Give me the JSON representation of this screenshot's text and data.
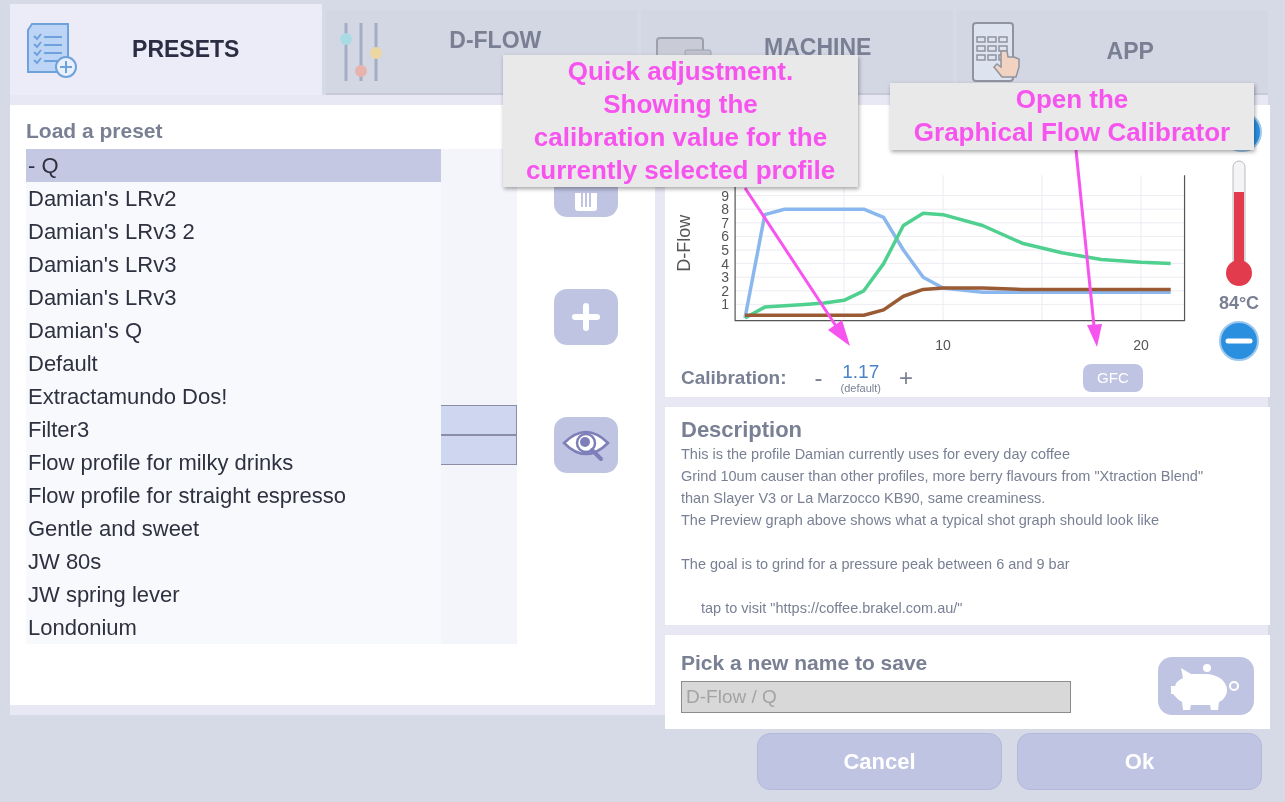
{
  "tabs": [
    {
      "label": "PRESETS",
      "selected": true
    },
    {
      "label": "D-FLOW",
      "selected": false
    },
    {
      "label": "MACHINE",
      "selected": false
    },
    {
      "label": "APP",
      "selected": false
    }
  ],
  "presets": {
    "title": "Load a preset",
    "items": [
      {
        "label": "-  Q",
        "selected": true
      },
      {
        "label": "Damian's LRv2",
        "selected": false
      },
      {
        "label": "Damian's LRv3 2",
        "selected": false
      },
      {
        "label": "Damian's LRv3",
        "selected": false
      },
      {
        "label": "Damian's LRv3",
        "selected": false
      },
      {
        "label": "Damian's Q",
        "selected": false
      },
      {
        "label": "Default",
        "selected": false
      },
      {
        "label": "Extractamundo Dos!",
        "selected": false
      },
      {
        "label": "Filter3",
        "selected": false
      },
      {
        "label": "Flow profile for milky drinks",
        "selected": false
      },
      {
        "label": "Flow profile for straight espresso",
        "selected": false
      },
      {
        "label": "Gentle and sweet",
        "selected": false
      },
      {
        "label": "JW 80s",
        "selected": false
      },
      {
        "label": "JW spring lever",
        "selected": false
      },
      {
        "label": "Londonium",
        "selected": false
      }
    ]
  },
  "preview": {
    "chart_data": {
      "type": "line",
      "ylabel": "D-Flow",
      "x": [
        0,
        1,
        2,
        3,
        4,
        5,
        6,
        7,
        8,
        9,
        10,
        12,
        14,
        16,
        18,
        20,
        21.5
      ],
      "series": [
        {
          "color": "#8ab8ee",
          "values": [
            0,
            7.6,
            8,
            8,
            8,
            8,
            8,
            7.4,
            5,
            3,
            2.2,
            1.9,
            1.9,
            1.9,
            1.9,
            1.9,
            1.9
          ]
        },
        {
          "color": "#4fd08f",
          "values": [
            0,
            0.8,
            0.9,
            1,
            1.1,
            1.3,
            2,
            4,
            6.8,
            7.7,
            7.6,
            6.8,
            5.5,
            4.8,
            4.3,
            4.1,
            4.0
          ]
        },
        {
          "color": "#9a5b34",
          "values": [
            0.2,
            0.2,
            0.2,
            0.2,
            0.2,
            0.2,
            0.2,
            0.6,
            1.6,
            2.1,
            2.2,
            2.2,
            2.1,
            2.1,
            2.1,
            2.1,
            2.1
          ]
        }
      ],
      "xlim": [
        -0.5,
        22.2
      ],
      "ylim": [
        -0.2,
        10.5
      ],
      "grid": true,
      "xticks": [
        10,
        20
      ],
      "yticks": [
        1,
        2,
        3,
        4,
        5,
        6,
        7,
        8,
        9
      ]
    },
    "calibration": {
      "label": "Calibration:",
      "minus": "-",
      "value": "1.17",
      "note": "(default)",
      "plus": "+"
    },
    "gfc_button": "GFC",
    "temperature": "84°C"
  },
  "description": {
    "title": "Description",
    "paragraphs": [
      [
        "This is the profile Damian currently uses for every day coffee",
        "Grind 10um causer than other profiles, more berry flavours from \"Xtraction Blend\"",
        "than Slayer V3 or La Marzocco KB90, same creaminess.",
        "The Preview graph above shows what a typical shot graph should look like"
      ],
      [
        "The goal is to grind for a pressure peak between 6 and 9 bar"
      ]
    ],
    "link": "tap to visit \"https://coffee.brakel.com.au/\""
  },
  "save": {
    "title": "Pick a new name to save",
    "placeholder": "D-Flow / Q"
  },
  "buttons": [
    "Cancel",
    "Ok"
  ],
  "callouts": [
    {
      "lines": [
        "Quick adjustment.",
        "Showing the",
        "calibration value for the",
        "currently selected profile"
      ]
    },
    {
      "lines": [
        "Open the",
        "Graphical Flow Calibrator"
      ]
    }
  ]
}
